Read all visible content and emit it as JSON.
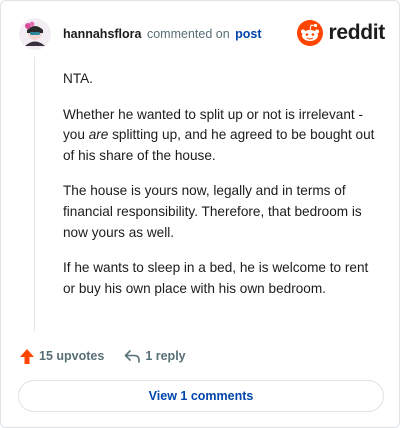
{
  "header": {
    "author": "hannahsflora",
    "action_text": "commented on",
    "target_link": "post",
    "brand": "reddit"
  },
  "icons": {
    "avatar": "avatar-icon",
    "brand_logo": "reddit-alien-icon",
    "upvote": "upvote-arrow-icon",
    "reply": "reply-arrow-icon"
  },
  "colors": {
    "brand": "#ff4500",
    "link": "#0045ac",
    "muted": "#576f76"
  },
  "comment": {
    "p1": "NTA.",
    "p2_before": "Whether he wanted to split up or not is irrelevant - you ",
    "p2_em": "are",
    "p2_after": " splitting up, and he agreed to be bought out of his share of the house.",
    "p3": "The house is yours now, legally and in terms of financial responsibility. Therefore, that bedroom is now yours as well.",
    "p4": "If he wants to sleep in a bed, he is welcome to rent or buy his own place with his own bedroom."
  },
  "actions": {
    "upvotes": "15 upvotes",
    "reply": "1 reply"
  },
  "footer": {
    "view_comments": "View 1 comments"
  }
}
